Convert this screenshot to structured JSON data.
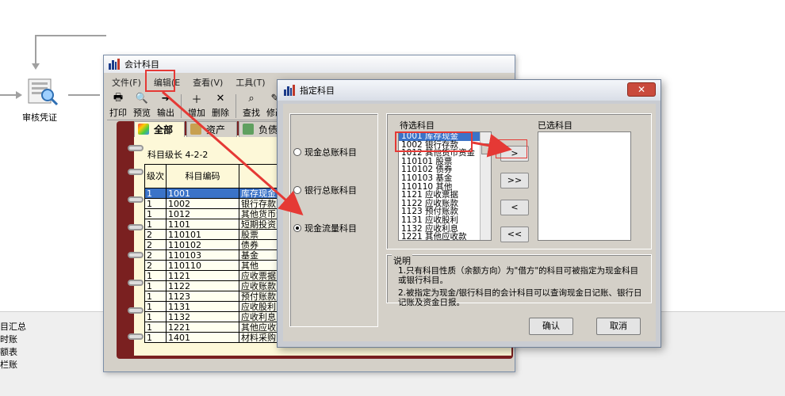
{
  "background": {
    "flow_label": "审核凭证",
    "left_items": [
      "目汇总",
      "时账",
      "额表",
      "栏账"
    ]
  },
  "main_window": {
    "title": "会计科目",
    "menu": [
      "文件(F)",
      "编辑(E",
      "查看(V)",
      "工具(T)"
    ],
    "toolbar": [
      {
        "label": "打印",
        "icon": "print-icon"
      },
      {
        "label": "预览",
        "icon": "preview-icon"
      },
      {
        "label": "输出",
        "icon": "export-icon"
      },
      {
        "label": "增加",
        "icon": "add-icon"
      },
      {
        "label": "删除",
        "icon": "delete-icon"
      },
      {
        "label": "查找",
        "icon": "find-icon"
      },
      {
        "label": "修改",
        "icon": "edit-icon"
      }
    ],
    "tabs": [
      "全部",
      "资产",
      "负债"
    ],
    "grade_label": "科目级长  4-2-2",
    "table": {
      "headers": [
        "级次",
        "科目编码",
        ""
      ],
      "rows": [
        [
          "1",
          "1001",
          "库存现金"
        ],
        [
          "1",
          "1002",
          "银行存款"
        ],
        [
          "1",
          "1012",
          "其他货币资金"
        ],
        [
          "1",
          "1101",
          "短期投资"
        ],
        [
          "2",
          "110101",
          "股票"
        ],
        [
          "2",
          "110102",
          "债券"
        ],
        [
          "2",
          "110103",
          "基金"
        ],
        [
          "2",
          "110110",
          "其他"
        ],
        [
          "1",
          "1121",
          "应收票据"
        ],
        [
          "1",
          "1122",
          "应收账款"
        ],
        [
          "1",
          "1123",
          "预付账款"
        ],
        [
          "1",
          "1131",
          "应收股利"
        ],
        [
          "1",
          "1132",
          "应收利息"
        ],
        [
          "1",
          "1221",
          "其他应收款"
        ],
        [
          "1",
          "1401",
          "材料采购"
        ]
      ],
      "selected_row": 0
    }
  },
  "dialog": {
    "title": "指定科目",
    "close_label": "✕",
    "radios": [
      {
        "label": "现金总账科目",
        "checked": false
      },
      {
        "label": "银行总账科目",
        "checked": false
      },
      {
        "label": "现金流量科目",
        "checked": true
      }
    ],
    "candidate_label": "待选科目",
    "selected_label": "已选科目",
    "candidates": [
      "1001    库存现金",
      "1002    银行存款",
      "1012    其他货币资金",
      "110101    股票",
      "110102    债券",
      "110103    基金",
      "110110    其他",
      "1121    应收票据",
      "1122    应收账款",
      "1123    预付账款",
      "1131    应收股利",
      "1132    应收利息",
      "1221    其他应收款"
    ],
    "move_buttons": [
      ">",
      ">>",
      "<",
      "<<"
    ],
    "desc_label": "说明",
    "desc_lines": [
      "1.只有科目性质（余额方向）为\"借方\"的科目可被指定为现金科目或银行科目。",
      "2.被指定为现金/银行科目的会计科目可以查询现金日记账、银行日记账及资金日报。"
    ],
    "ok_label": "确认",
    "cancel_label": "取消"
  },
  "colors": {
    "highlight": "#e53935",
    "selection": "#3b73c8",
    "notebook": "#7a2020"
  }
}
